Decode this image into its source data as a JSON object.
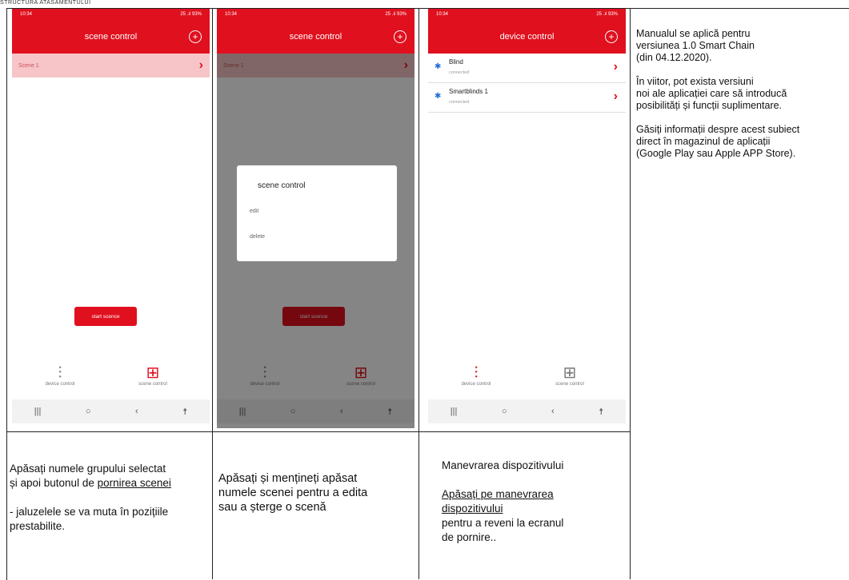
{
  "header_fragment": "STRUCTURA ATASAMENTULUI",
  "panel1": {
    "status_time": "10:34",
    "status_right": "25 .ıl 93%",
    "title": "scene control",
    "scene_name": "Scene 1",
    "start_button": "start scence",
    "tab_device": "device control",
    "tab_scene": "scene control",
    "caption_line1": "Apăsați numele grupului selectat",
    "caption_line2_prefix": "și apoi butonul de ",
    "caption_line2_link": "pornirea scenei",
    "caption_line3": "- jaluzelele se va muta în pozițiile",
    "caption_line4": "prestabilite."
  },
  "panel2": {
    "status_time": "10:34",
    "status_right": "25 .ıl 93%",
    "title": "scene control",
    "scene_name": "Scene 1",
    "dialog_title": "scene control",
    "dialog_edit": "edit",
    "dialog_delete": "delete",
    "start_button": "start scence",
    "tab_device": "device control",
    "tab_scene": "scene control",
    "caption_line1": "Apăsați și mențineți apăsat",
    "caption_line2": "numele scenei pentru a edita",
    "caption_line3": "sau a șterge o scenă"
  },
  "panel3": {
    "status_time": "10:34",
    "status_right": "25 .ıl 93%",
    "title": "device control",
    "devices": [
      {
        "name": "Blind",
        "status": "connected"
      },
      {
        "name": "Smartblinds 1",
        "status": "connected"
      }
    ],
    "tab_device": "device control",
    "tab_scene": "scene control",
    "caption_title": "Manevrarea dispozitivului",
    "caption_line1": "Apăsați pe manevrarea",
    "caption_line2": "dispozitivului",
    "caption_line3": "pentru a reveni la ecranul",
    "caption_line4": "de pornire.."
  },
  "info": {
    "p1": "Manualul se aplică pentru\nversiunea 1.0 Smart Chain\n(din 04.12.2020).",
    "p2": "În viitor, pot exista versiuni\nnoi ale aplicației care să introducă\nposibilități și funcții suplimentare.",
    "p3": "Găsiți informații despre acest subiect\n direct în magazinul de aplicații\n(Google Play sau Apple APP Store)."
  },
  "colors": {
    "accent": "#e0101e",
    "bluetooth": "#1f6fd8"
  }
}
